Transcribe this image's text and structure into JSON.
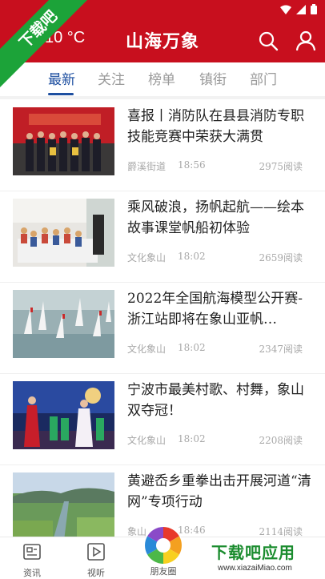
{
  "header": {
    "temperature": "10 °C",
    "title": "山海万象"
  },
  "watermark": {
    "ribbon_text": "下载吧",
    "brand": "下载吧应用",
    "url": "www.xiazaiMiao.com"
  },
  "tabs": [
    {
      "label": "最新",
      "active": true
    },
    {
      "label": "关注",
      "active": false
    },
    {
      "label": "榜单",
      "active": false
    },
    {
      "label": "镇街",
      "active": false
    },
    {
      "label": "部门",
      "active": false
    }
  ],
  "news": [
    {
      "title": "喜报丨消防队在县县消防专职技能竞赛中荣获大满贯",
      "source": "爵溪街道",
      "time": "18:56",
      "reads": "2975阅读"
    },
    {
      "title": "乘风破浪，扬帆起航——绘本故事课堂帆船初体验",
      "source": "文化象山",
      "time": "18:02",
      "reads": "2659阅读"
    },
    {
      "title": "2022年全国航海模型公开赛-浙江站即将在象山亚帆…",
      "source": "文化象山",
      "time": "18:02",
      "reads": "2347阅读"
    },
    {
      "title": "宁波市最美村歌、村舞，象山双夺冠！",
      "source": "文化象山",
      "time": "18:02",
      "reads": "2208阅读"
    },
    {
      "title": "黄避岙乡重拳出击开展河道“清网”专项行动",
      "source": "象山",
      "time": "18:46",
      "reads": "2114阅读"
    }
  ],
  "bottom_nav": [
    {
      "label": "资讯"
    },
    {
      "label": "视听"
    },
    {
      "label": "朋友圈"
    }
  ],
  "colors": {
    "brand_red": "#c80f1e",
    "tab_active": "#1e4fa0",
    "watermark_green": "#1ca339"
  }
}
